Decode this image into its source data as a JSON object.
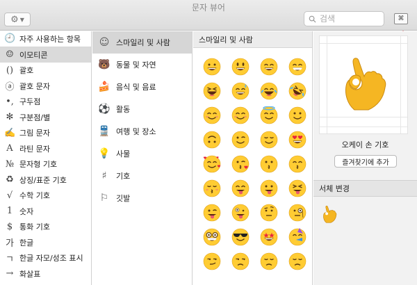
{
  "window": {
    "title": "문자 뷰어"
  },
  "toolbar": {
    "gear_icon": "gear-icon",
    "search_placeholder": "검색",
    "keyboard_viewer_icon": "command-key-icon",
    "keyboard_glyph": "⌘"
  },
  "sidebar": {
    "items": [
      {
        "label": "자주 사용하는 항목",
        "icon": "clock-icon",
        "glyph": "🕘",
        "selected": false
      },
      {
        "label": "이모티콘",
        "icon": "smiley-icon",
        "glyph": "☺",
        "selected": true
      },
      {
        "label": "괄호",
        "icon": "parentheses-icon",
        "glyph": "()",
        "selected": false
      },
      {
        "label": "괄호 문자",
        "icon": "circled-a-icon",
        "glyph": "ⓐ",
        "selected": false
      },
      {
        "label": "구두점",
        "icon": "punctuation-icon",
        "glyph": "•,",
        "selected": false
      },
      {
        "label": "구분점/별",
        "icon": "asterisk-icon",
        "glyph": "✻",
        "selected": false
      },
      {
        "label": "그림 문자",
        "icon": "writing-hand-icon",
        "glyph": "✍",
        "selected": false
      },
      {
        "label": "라틴 문자",
        "icon": "latin-a-icon",
        "glyph": "A",
        "selected": false
      },
      {
        "label": "문자형 기호",
        "icon": "numero-icon",
        "glyph": "№",
        "selected": false
      },
      {
        "label": "상징/표준 기호",
        "icon": "recycle-icon",
        "glyph": "♻",
        "selected": false
      },
      {
        "label": "수학 기호",
        "icon": "square-root-icon",
        "glyph": "√",
        "selected": false
      },
      {
        "label": "숫자",
        "icon": "digit-one-icon",
        "glyph": "1",
        "selected": false
      },
      {
        "label": "통화 기호",
        "icon": "dollar-icon",
        "glyph": "$",
        "selected": false
      },
      {
        "label": "한글",
        "icon": "hangul-icon",
        "glyph": "가",
        "selected": false
      },
      {
        "label": "한글 자모/성조 표시",
        "icon": "jamo-icon",
        "glyph": "ㄱ",
        "selected": false
      },
      {
        "label": "화살표",
        "icon": "arrow-icon",
        "glyph": "→",
        "selected": false
      }
    ]
  },
  "categories": {
    "items": [
      {
        "label": "스마일리 및 사람",
        "icon": "smiley-outline-icon",
        "glyph": "☺",
        "selected": true
      },
      {
        "label": "동물 및 자연",
        "icon": "bear-icon",
        "glyph": "🐻",
        "selected": false
      },
      {
        "label": "음식 및 음료",
        "icon": "cake-icon",
        "glyph": "🍰",
        "selected": false
      },
      {
        "label": "활동",
        "icon": "soccer-ball-icon",
        "glyph": "⚽",
        "selected": false
      },
      {
        "label": "여행 및 장소",
        "icon": "train-icon",
        "glyph": "🚆",
        "selected": false
      },
      {
        "label": "사물",
        "icon": "lightbulb-icon",
        "glyph": "💡",
        "selected": false
      },
      {
        "label": "기호",
        "icon": "symbols-icon",
        "glyph": "♯",
        "selected": false
      },
      {
        "label": "깃발",
        "icon": "flag-icon",
        "glyph": "⚐",
        "selected": false
      }
    ]
  },
  "grid": {
    "header": "스마일리 및 사람",
    "emojis": [
      {
        "name": "grinning-face",
        "base": "#ffcc33",
        "eyes": "dots",
        "mouth": "grin"
      },
      {
        "name": "grinning-face-big-eyes",
        "base": "#ffcc33",
        "eyes": "ovals",
        "mouth": "grin"
      },
      {
        "name": "grinning-face-smiling-eyes",
        "base": "#ffcc33",
        "eyes": "arcs",
        "mouth": "grin"
      },
      {
        "name": "beaming-face",
        "base": "#ffcc33",
        "eyes": "arcs",
        "mouth": "teeth"
      },
      {
        "name": "squinting-face",
        "base": "#ffcc33",
        "eyes": "xx",
        "mouth": "open"
      },
      {
        "name": "grinning-face-sweat",
        "base": "#ffcc33",
        "eyes": "arcs",
        "mouth": "grin",
        "extra": "sweat"
      },
      {
        "name": "face-tears-of-joy",
        "base": "#ffcc33",
        "eyes": "arcs",
        "mouth": "open",
        "extra": "tears"
      },
      {
        "name": "rolling-laughing",
        "base": "#ffcc33",
        "eyes": "xx",
        "mouth": "open",
        "extra": "tears",
        "tilt": 30
      },
      {
        "name": "smiling-face",
        "base": "#ffcc33",
        "eyes": "arcs",
        "mouth": "smile",
        "extra": "blush"
      },
      {
        "name": "smiling-face-smiling-eyes",
        "base": "#ffcc33",
        "eyes": "arcs",
        "mouth": "smile",
        "extra": "blush"
      },
      {
        "name": "smiling-face-halo",
        "base": "#ffcc33",
        "eyes": "arcs",
        "mouth": "smile",
        "extra": "halo"
      },
      {
        "name": "slightly-smiling-face",
        "base": "#ffcc33",
        "eyes": "dots",
        "mouth": "smile"
      },
      {
        "name": "upside-down-face",
        "base": "#ffcc33",
        "eyes": "dots",
        "mouth": "smile",
        "tilt": 180
      },
      {
        "name": "winking-face",
        "base": "#ffcc33",
        "eyes": "wink",
        "mouth": "smile"
      },
      {
        "name": "relieved-face",
        "base": "#ffcc33",
        "eyes": "closed",
        "mouth": "smile"
      },
      {
        "name": "heart-eyes",
        "base": "#ffcc33",
        "eyes": "hearts",
        "mouth": "grin"
      },
      {
        "name": "smiling-hearts",
        "base": "#ffcc33",
        "eyes": "arcs",
        "mouth": "smile",
        "extra": "hearts"
      },
      {
        "name": "face-blowing-kiss",
        "base": "#ffcc33",
        "eyes": "wink",
        "mouth": "kiss",
        "extra": "heart"
      },
      {
        "name": "kissing-face",
        "base": "#ffcc33",
        "eyes": "dots",
        "mouth": "kiss"
      },
      {
        "name": "kissing-smiling-eyes",
        "base": "#ffcc33",
        "eyes": "arcs",
        "mouth": "kiss"
      },
      {
        "name": "kissing-closed-eyes",
        "base": "#ffcc33",
        "eyes": "closed",
        "mouth": "kiss",
        "extra": "blush"
      },
      {
        "name": "yum-face",
        "base": "#ffcc33",
        "eyes": "arcs",
        "mouth": "tongue"
      },
      {
        "name": "tongue-face",
        "base": "#ffcc33",
        "eyes": "dots",
        "mouth": "tongue"
      },
      {
        "name": "squint-tongue",
        "base": "#ffcc33",
        "eyes": "xx",
        "mouth": "tongue"
      },
      {
        "name": "wink-tongue",
        "base": "#ffcc33",
        "eyes": "wink",
        "mouth": "tongue"
      },
      {
        "name": "zany-face",
        "base": "#ffcc33",
        "eyes": "crazy",
        "mouth": "tongue"
      },
      {
        "name": "face-raised-eyebrow",
        "base": "#ffcc33",
        "eyes": "brow",
        "mouth": "flat"
      },
      {
        "name": "monocle-face",
        "base": "#ffcc33",
        "eyes": "monocle",
        "mouth": "flat"
      },
      {
        "name": "nerd-face",
        "base": "#ffcc33",
        "eyes": "glasses",
        "mouth": "teeth"
      },
      {
        "name": "sunglasses-face",
        "base": "#ffcc33",
        "eyes": "shades",
        "mouth": "smile"
      },
      {
        "name": "star-struck",
        "base": "#ffcc33",
        "eyes": "stars",
        "mouth": "grin"
      },
      {
        "name": "partying-face",
        "base": "#ffcc33",
        "eyes": "arcs",
        "mouth": "horn",
        "extra": "hat"
      },
      {
        "name": "smirking-face",
        "base": "#ffcc33",
        "eyes": "side",
        "mouth": "smirk"
      },
      {
        "name": "unamused-face",
        "base": "#ffcc33",
        "eyes": "side",
        "mouth": "frown"
      },
      {
        "name": "disappointed-face",
        "base": "#ffcc33",
        "eyes": "closed",
        "mouth": "frown"
      },
      {
        "name": "pensive-face",
        "base": "#ffcc33",
        "eyes": "closed",
        "mouth": "frown"
      }
    ]
  },
  "detail": {
    "selected_icon": "ok-hand-icon",
    "name": "오케이 손 기호",
    "add_favorites_label": "즐겨찾기에 추가",
    "font_variation_label": "서체 변경",
    "hand_color": "#f5b623"
  },
  "colors": {
    "accent_arrow": "#e5141b",
    "selected_row": "#dadada",
    "emoji_base": "#ffcc33"
  }
}
